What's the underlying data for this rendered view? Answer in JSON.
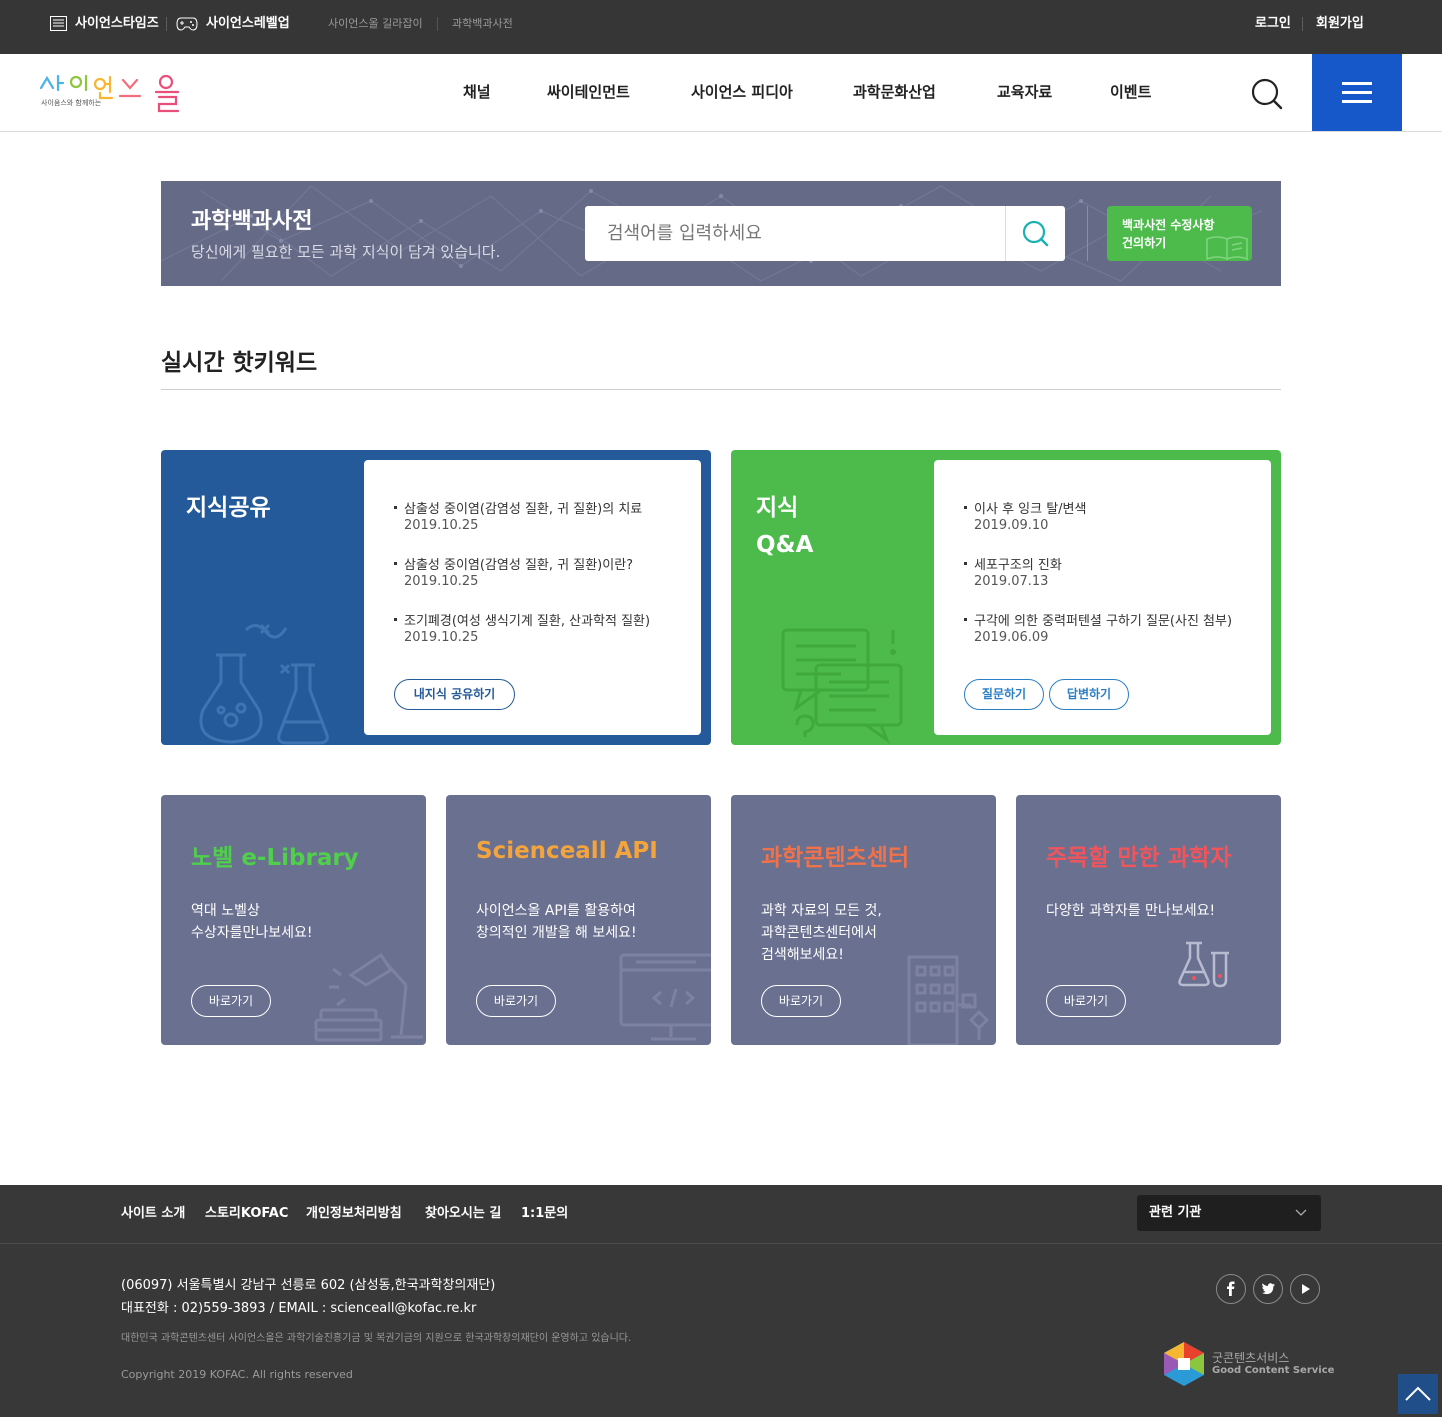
{
  "topbar": {
    "site1": "사이언스타임즈",
    "site2": "사이언스레벨업",
    "link1": "사이언스올 길라잡이",
    "link2": "과학백과사전",
    "login": "로그인",
    "signup": "회원가입"
  },
  "header": {
    "logo_text": "사이언스올",
    "logo_tagline": "사이움스와 함께하는",
    "nav": [
      "채널",
      "싸이테인먼트",
      "사이언스 피디아",
      "과학문화산업",
      "교육자료",
      "이벤트"
    ]
  },
  "banner": {
    "title": "과학백과사전",
    "desc": "당신에게 필요한 모든 과학 지식이 담겨 있습니다.",
    "search_placeholder": "검색어를 입력하세요",
    "suggest_line1": "백과사전 수정사항",
    "suggest_line2": "건의하기"
  },
  "hot": {
    "title": "실시간 핫키워드"
  },
  "share": {
    "title": "지식공유",
    "posts": [
      {
        "title": "삼출성 중이염(감염성 질환, 귀 질환)의 치료",
        "date": "2019.10.25"
      },
      {
        "title": "삼출성 중이염(감염성 질환, 귀 질환)이란?",
        "date": "2019.10.25"
      },
      {
        "title": "조기폐경(여성 생식기계 질환, 산과학적 질환)",
        "date": "2019.10.25"
      }
    ],
    "button": "내지식 공유하기"
  },
  "qa": {
    "title_line1": "지식",
    "title_line2": "Q&A",
    "posts": [
      {
        "title": "이사 후 잉크 탈/변색",
        "date": "2019.09.10"
      },
      {
        "title": "세포구조의 진화",
        "date": "2019.07.13"
      },
      {
        "title": "구각에 의한 중력퍼텐셜 구하기 질문(사진 첨부)",
        "date": "2019.06.09"
      }
    ],
    "ask_button": "질문하기",
    "answer_button": "답변하기"
  },
  "features": [
    {
      "title": "노벨 e-Library",
      "color": "#4fcf4c",
      "desc": [
        "역대 노벨상",
        "수상자를만나보세요!"
      ],
      "button": "바로가기"
    },
    {
      "title": "Scienceall API",
      "color": "#f3a43c",
      "desc": [
        "사이언스올 API를 활용하여",
        "창의적인 개발을 해 보세요!"
      ],
      "button": "바로가기"
    },
    {
      "title": "과학콘텐츠센터",
      "color": "#f0724a",
      "desc": [
        "과학 자료의 모든 것,",
        "과학콘텐츠센터에서",
        "검색해보세요!"
      ],
      "button": "바로가기"
    },
    {
      "title": "주목할 만한 과학자",
      "color": "#f2545b",
      "desc": [
        "다양한 과학자를 만나보세요!"
      ],
      "button": "바로가기"
    }
  ],
  "footer": {
    "nav": [
      "사이트 소개",
      "스토리KOFAC",
      "개인정보처리방침",
      "찾아오시는 길",
      "1:1문의"
    ],
    "related": "관련 기관",
    "address": "(06097) 서울특별시 강남구 선릉로 602 (삼성동,한국과학창의재단)",
    "contact": "대표전화 : 02)559-3893 / EMAIL : scienceall@kofac.re.kr",
    "note": "대한민국 과학콘텐츠센터 사이언스올은 과학기술진흥기금 및 복권기금의 지원으로 한국과학창의재단이 운영하고 있습니다.",
    "copyright": "Copyright 2019 KOFAC. All rights reserved",
    "gcs_korean": "굿콘텐츠서비스",
    "gcs_english": "Good Content Service"
  },
  "colors": {
    "topbar": "#363636",
    "menu_button": "#1657c9",
    "banner": "#656b86",
    "suggest": "#4dbb4c",
    "share_panel": "#245a99",
    "qa_panel": "#4dbb4c",
    "feature_card": "#6a7090",
    "footer": "#383838"
  }
}
